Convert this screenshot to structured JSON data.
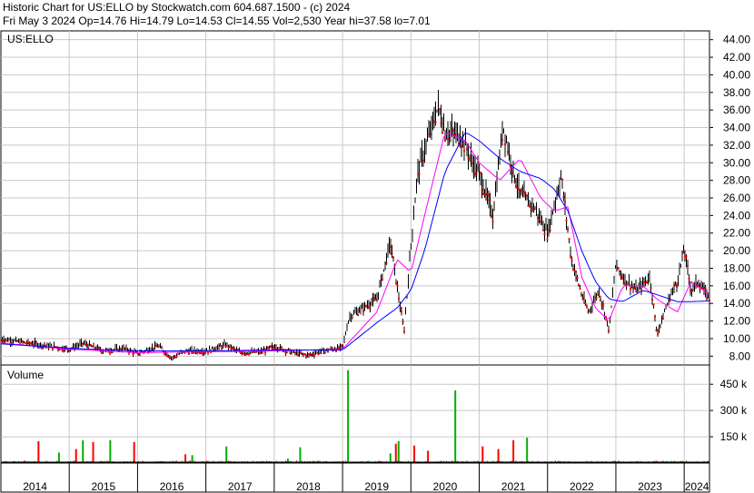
{
  "header": {
    "line1": "Historic Chart for US:ELLO by Stockwatch.com 604.687.1500 - (c) 2024",
    "line2": "Fri May  3 2024   Op=14.76   Hi=14.79   Lo=14.53   Cl=14.55   Vol=2,530   Year hi=37.58   lo=7.01"
  },
  "chart_data": [
    {
      "type": "line",
      "title": "",
      "legend_label": "US:ELLO",
      "xlabel": "",
      "ylabel": "",
      "grid": true,
      "ylim": [
        7,
        45
      ],
      "yticks": [
        "44.00",
        "42.00",
        "40.00",
        "38.00",
        "36.00",
        "34.00",
        "32.00",
        "30.00",
        "28.00",
        "26.00",
        "24.00",
        "22.00",
        "20.00",
        "18.00",
        "16.00",
        "14.00",
        "12.00",
        "10.00",
        "8.00"
      ],
      "xlim": [
        2014.0,
        2024.37
      ],
      "xticks": [
        "2014",
        "2015",
        "2016",
        "2017",
        "2018",
        "2019",
        "2020",
        "2021",
        "2022",
        "2023",
        "2024"
      ],
      "colors": {
        "price": "#000000",
        "down_mark": "#ff0000",
        "ma_short": "#ff00ff",
        "ma_long": "#0000ff"
      },
      "series": [
        {
          "name": "price",
          "x": [
            2014.0,
            2014.3,
            2014.6,
            2015.0,
            2015.2,
            2015.5,
            2015.8,
            2016.0,
            2016.3,
            2016.5,
            2016.7,
            2017.0,
            2017.3,
            2017.5,
            2017.8,
            2018.0,
            2018.3,
            2018.5,
            2018.7,
            2019.0,
            2019.1,
            2019.3,
            2019.5,
            2019.7,
            2019.9,
            2020.0,
            2020.1,
            2020.3,
            2020.4,
            2020.5,
            2020.7,
            2020.8,
            2020.9,
            2021.0,
            2021.2,
            2021.35,
            2021.5,
            2021.6,
            2021.8,
            2022.0,
            2022.2,
            2022.35,
            2022.5,
            2022.6,
            2022.75,
            2022.9,
            2023.0,
            2023.1,
            2023.3,
            2023.5,
            2023.6,
            2023.8,
            2023.9,
            2024.0,
            2024.1,
            2024.2,
            2024.37
          ],
          "y": [
            10.0,
            9.6,
            9.3,
            8.8,
            9.5,
            8.6,
            8.9,
            8.3,
            9.2,
            7.8,
            8.6,
            8.6,
            9.3,
            8.4,
            8.5,
            9.1,
            8.4,
            8.1,
            8.6,
            9.0,
            12.5,
            13.5,
            14.5,
            21.0,
            10.8,
            20.5,
            29.0,
            34.0,
            36.5,
            33.5,
            33.2,
            32.0,
            30.0,
            28.8,
            24.0,
            34.2,
            29.0,
            26.5,
            25.0,
            22.0,
            28.5,
            19.0,
            15.0,
            13.0,
            15.5,
            11.0,
            18.5,
            17.0,
            15.5,
            17.0,
            10.5,
            15.0,
            16.5,
            20.2,
            15.5,
            16.5,
            14.55
          ]
        },
        {
          "name": "ma_short",
          "x": [
            2014.0,
            2015.0,
            2016.0,
            2017.0,
            2018.0,
            2019.0,
            2019.5,
            2019.8,
            2020.0,
            2020.2,
            2020.5,
            2020.8,
            2021.0,
            2021.3,
            2021.6,
            2021.9,
            2022.1,
            2022.3,
            2022.5,
            2022.7,
            2022.9,
            2023.1,
            2023.4,
            2023.6,
            2023.9,
            2024.1,
            2024.37
          ],
          "y": [
            9.5,
            8.8,
            8.4,
            8.5,
            8.6,
            8.8,
            13.0,
            19.0,
            17.5,
            24.0,
            33.5,
            32.5,
            30.0,
            28.0,
            30.5,
            26.0,
            24.5,
            25.0,
            17.0,
            13.5,
            12.0,
            16.0,
            16.0,
            14.5,
            13.0,
            16.5,
            15.0
          ]
        },
        {
          "name": "ma_long",
          "x": [
            2014.0,
            2015.0,
            2016.0,
            2017.0,
            2018.0,
            2019.0,
            2019.5,
            2019.8,
            2020.0,
            2020.2,
            2020.5,
            2020.8,
            2021.0,
            2021.3,
            2021.6,
            2021.9,
            2022.1,
            2022.3,
            2022.5,
            2022.7,
            2022.9,
            2023.1,
            2023.4,
            2023.6,
            2023.9,
            2024.1,
            2024.37
          ],
          "y": [
            9.4,
            8.9,
            8.6,
            8.6,
            8.7,
            8.7,
            11.8,
            13.5,
            15.5,
            20.0,
            29.0,
            33.5,
            32.5,
            30.5,
            29.0,
            28.2,
            27.0,
            24.5,
            20.0,
            16.5,
            14.5,
            14.2,
            15.5,
            15.0,
            14.2,
            14.2,
            14.3
          ]
        }
      ]
    },
    {
      "type": "bar",
      "title": "",
      "legend_label": "Volume",
      "xlabel": "",
      "ylabel": "",
      "grid": true,
      "ylim": [
        0,
        560000
      ],
      "yticks": [
        "450 k",
        "300 k",
        "150 k"
      ],
      "xlim": [
        2014.0,
        2024.37
      ],
      "colors": {
        "up": "#00b000",
        "down": "#ff0000",
        "base": "#000000"
      },
      "spikes": [
        {
          "x": 2014.55,
          "v": 125000,
          "dir": "down"
        },
        {
          "x": 2014.85,
          "v": 60000,
          "dir": "up"
        },
        {
          "x": 2015.1,
          "v": 80000,
          "dir": "down"
        },
        {
          "x": 2015.2,
          "v": 130000,
          "dir": "up"
        },
        {
          "x": 2015.35,
          "v": 120000,
          "dir": "down"
        },
        {
          "x": 2015.6,
          "v": 130000,
          "dir": "up"
        },
        {
          "x": 2015.95,
          "v": 120000,
          "dir": "down"
        },
        {
          "x": 2016.7,
          "v": 50000,
          "dir": "down"
        },
        {
          "x": 2016.8,
          "v": 45000,
          "dir": "up"
        },
        {
          "x": 2017.3,
          "v": 95000,
          "dir": "up"
        },
        {
          "x": 2018.2,
          "v": 25000,
          "dir": "up"
        },
        {
          "x": 2018.38,
          "v": 90000,
          "dir": "up"
        },
        {
          "x": 2019.08,
          "v": 530000,
          "dir": "up"
        },
        {
          "x": 2019.7,
          "v": 55000,
          "dir": "up"
        },
        {
          "x": 2019.78,
          "v": 110000,
          "dir": "down"
        },
        {
          "x": 2019.82,
          "v": 125000,
          "dir": "up"
        },
        {
          "x": 2020.05,
          "v": 100000,
          "dir": "down"
        },
        {
          "x": 2020.25,
          "v": 70000,
          "dir": "down"
        },
        {
          "x": 2020.65,
          "v": 415000,
          "dir": "up"
        },
        {
          "x": 2021.05,
          "v": 95000,
          "dir": "down"
        },
        {
          "x": 2021.28,
          "v": 80000,
          "dir": "down"
        },
        {
          "x": 2021.5,
          "v": 130000,
          "dir": "down"
        },
        {
          "x": 2021.7,
          "v": 145000,
          "dir": "up"
        }
      ]
    }
  ]
}
